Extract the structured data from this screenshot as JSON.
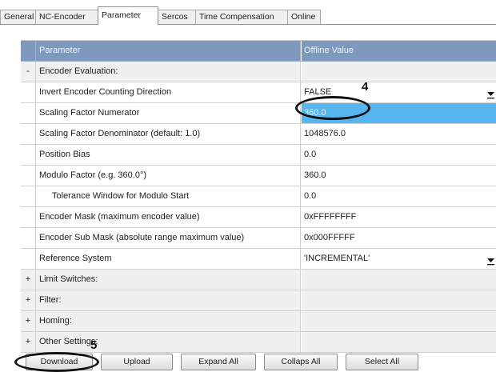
{
  "tabs": [
    "General",
    "NC-Encoder",
    "Parameter",
    "Sercos",
    "Time Compensation",
    "Online"
  ],
  "active_tab": "Parameter",
  "table": {
    "columns": [
      "Parameter",
      "Offline Value"
    ],
    "rows": [
      {
        "expander": "-",
        "name": "Encoder Evaluation:",
        "value": ""
      },
      {
        "expander": "",
        "name": "Invert Encoder Counting Direction",
        "value": "FALSE",
        "dropdown": true
      },
      {
        "expander": "",
        "name": "Scaling Factor Numerator",
        "value": "360.0",
        "selected": true
      },
      {
        "expander": "",
        "name": "Scaling Factor Denominator (default: 1.0)",
        "value": "1048576.0"
      },
      {
        "expander": "",
        "name": "Position Bias",
        "value": "0.0"
      },
      {
        "expander": "",
        "name": "Modulo Factor (e.g. 360.0°)",
        "value": "360.0"
      },
      {
        "expander": "",
        "name": "Tolerance Window for Modulo Start",
        "value": "0.0",
        "indent": true
      },
      {
        "expander": "",
        "name": "Encoder Mask (maximum encoder value)",
        "value": "0xFFFFFFFF"
      },
      {
        "expander": "",
        "name": "Encoder Sub Mask (absolute range maximum value)",
        "value": "0x000FFFFF"
      },
      {
        "expander": "",
        "name": "Reference System",
        "value": "'INCREMENTAL'",
        "dropdown": true
      },
      {
        "expander": "+",
        "name": "Limit Switches:",
        "value": ""
      },
      {
        "expander": "+",
        "name": "Filter:",
        "value": ""
      },
      {
        "expander": "+",
        "name": "Homing:",
        "value": ""
      },
      {
        "expander": "+",
        "name": "Other Settings:",
        "value": ""
      }
    ]
  },
  "buttons": [
    "Download",
    "Upload",
    "Expand All",
    "Collaps All",
    "Select All"
  ],
  "annotations": {
    "marker_value": "4",
    "marker_download": "5"
  },
  "colors": {
    "header": "#7e99bd",
    "selected": "#56b4ef",
    "group": "#f0f0f0"
  }
}
